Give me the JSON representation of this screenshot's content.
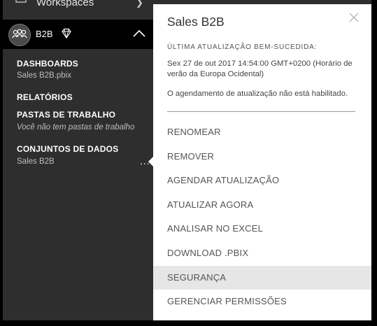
{
  "nav": {
    "workspaces_label": "Workspaces",
    "group_name": "B2B",
    "sections": [
      {
        "title": "DASHBOARDS",
        "sub": "Sales B2B.pbix"
      },
      {
        "title": "RELATÓRIOS",
        "sub": ""
      },
      {
        "title": "PASTAS DE TRABALHO",
        "sub": "Você não tem pastas de trabalho"
      },
      {
        "title": "CONJUNTOS DE DADOS",
        "sub": "Sales B2B"
      }
    ],
    "more_label": "..."
  },
  "panel": {
    "title": "Sales B2B",
    "last_refresh_label": "ÚLTIMA ATUALIZAÇÃO BEM-SUCEDIDA:",
    "last_refresh_value": "Sex 27 de out 2017 14:54:00 GMT+0200 (Horário de verão da Europa Ocidental)",
    "schedule_status": "O agendamento de atualização não está habilitado.",
    "menu": [
      "RENOMEAR",
      "REMOVER",
      "AGENDAR ATUALIZAÇÃO",
      "ATUALIZAR AGORA",
      "ANALISAR NO EXCEL",
      "DOWNLOAD .PBIX",
      "SEGURANÇA",
      "GERENCIAR PERMISSÕES"
    ],
    "highlighted_item": "SEGURANÇA"
  },
  "colors": {
    "nav_bg": "#2e2e2e",
    "group_bg": "#000000",
    "panel_bg": "#ffffff",
    "highlight_bg": "#e6e6e6"
  },
  "icons": [
    "workspaces-icon",
    "chevron-right-icon",
    "group-avatar-icon",
    "diamond-icon",
    "chevron-up-icon",
    "close-icon",
    "more-options-icon"
  ]
}
